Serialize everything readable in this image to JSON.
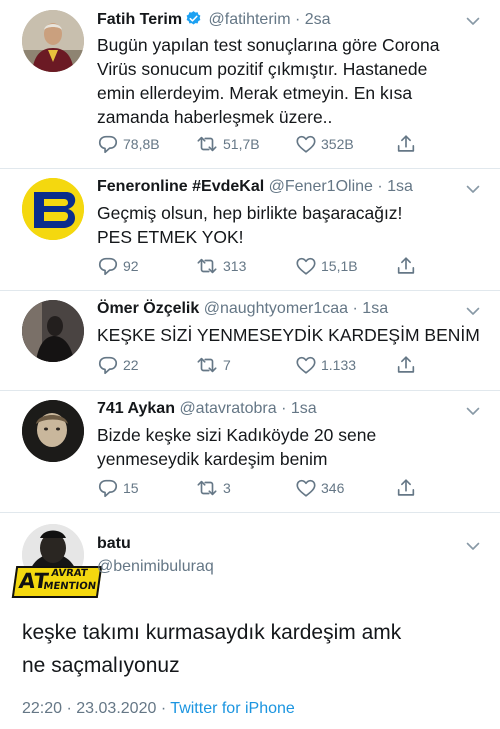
{
  "tweets": [
    {
      "name": "Fatih Terim",
      "handle": "@fatihterim",
      "time": "2sa",
      "text_lines": [
        "Bugün yapılan test sonuçlarına göre Corona",
        "Virüs sonucum pozitif çıkmıştır. Hastanede",
        "emin ellerdeyim. Merak etmeyin. En kısa",
        "zamanda haberleşmek üzere.."
      ],
      "replies": "78,8B",
      "retweets": "51,7B",
      "likes": "352B"
    },
    {
      "name": "Feneronline #EvdeKal",
      "handle": "@Fener1Oline",
      "time": "1sa",
      "text_lines": [
        "Geçmiş olsun, hep birlikte başaracağız!",
        "PES ETMEK YOK!"
      ],
      "replies": "92",
      "retweets": "313",
      "likes": "15,1B"
    },
    {
      "name": "Ömer Özçelik",
      "handle": "@naughtyomer1caa",
      "time": "1sa",
      "text_lines": [
        "KEŞKE SİZİ YENMESEYDİK KARDEŞİM BENİM"
      ],
      "replies": "22",
      "retweets": "7",
      "likes": "1.133"
    },
    {
      "name": "741 Aykan",
      "handle": "@atavratobra",
      "time": "1sa",
      "text_lines": [
        "Bizde keşke sizi Kadıköyde 20 sene",
        "yenmeseydik kardeşim benim"
      ],
      "replies": "15",
      "retweets": "3",
      "likes": "346"
    }
  ],
  "main_tweet": {
    "name": "batu",
    "handle": "@benimibuluraq",
    "badge_top": "AVRAT",
    "badge_left": "AT",
    "badge_bottom": "MENTION",
    "text_lines": [
      "keşke takımı kurmasaydık kardeşim amk",
      "ne saçmalıyonuz"
    ],
    "time": "22:20",
    "date": "23.03.2020",
    "source": "Twitter for iPhone"
  },
  "colors": {
    "accent": "#1b95e0",
    "muted": "#657786",
    "fener_yellow": "#f4d80f",
    "fener_blue": "#0a2d8c"
  },
  "icons": [
    "verified-badge-icon",
    "chevron-down-icon",
    "reply-icon",
    "retweet-icon",
    "like-icon",
    "share-icon"
  ]
}
